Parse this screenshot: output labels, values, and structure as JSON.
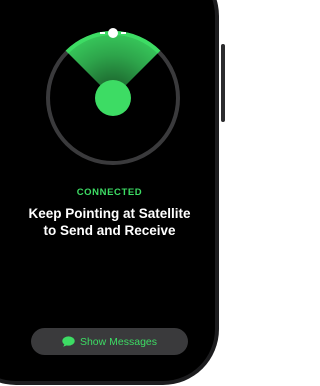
{
  "satellite_status": {
    "status_text": "CONNECTED",
    "instruction": "Keep Pointing at Satellite\nto Send and Receive"
  },
  "actions": {
    "show_messages_label": "Show Messages"
  },
  "icons": {
    "radar": "satellite-pointer-icon",
    "button": "message-bubble-icon"
  },
  "colors": {
    "accent_green": "#3ddc64",
    "background": "#000000",
    "button_bg": "#3a3a3c"
  }
}
